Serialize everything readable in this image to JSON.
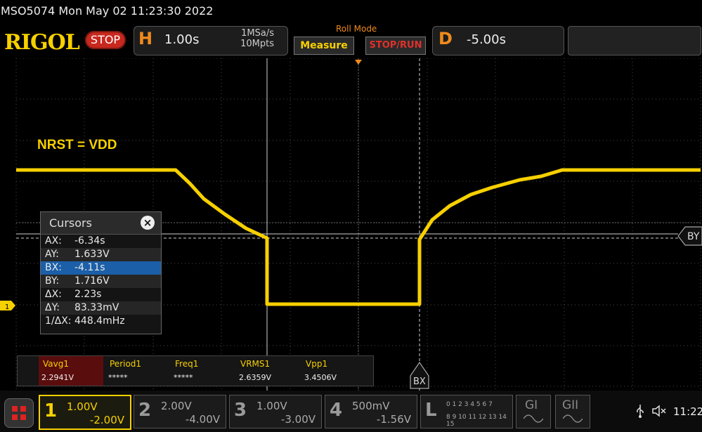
{
  "header": {
    "title": "MSO5074  Mon May 02 11:23:30 2022",
    "logo": "RIGOL",
    "run_state": "STOP"
  },
  "horizontal": {
    "letter": "H",
    "timebase": "1.00s",
    "sample_rate": "1MSa/s",
    "memory_depth": "10Mpts"
  },
  "mode": {
    "label": "Roll Mode",
    "measure_button": "Measure",
    "stoprun_button": "STOP/RUN"
  },
  "delay": {
    "letter": "D",
    "value": "-5.00s"
  },
  "annotation": "NRST = VDD",
  "markers": {
    "ch1": "1",
    "by": "BY",
    "bx": "BX"
  },
  "cursors": {
    "title": "Cursors",
    "close": "×",
    "rows": [
      {
        "k": "AX:",
        "v": "-6.34s"
      },
      {
        "k": "AY:",
        "v": "1.633V"
      },
      {
        "k": "BX:",
        "v": "-4.11s"
      },
      {
        "k": "BY:",
        "v": "1.716V"
      },
      {
        "k": "ΔX:",
        "v": "2.23s"
      },
      {
        "k": "ΔY:",
        "v": "83.33mV"
      },
      {
        "k": "1/ΔX:",
        "v": "448.4mHz"
      }
    ]
  },
  "measurements": [
    {
      "name": "Vavg1",
      "value": "2.2941V"
    },
    {
      "name": "Period1",
      "value": "*****"
    },
    {
      "name": "Freq1",
      "value": "*****"
    },
    {
      "name": "VRMS1",
      "value": "2.6359V"
    },
    {
      "name": "Vpp1",
      "value": "3.4506V"
    }
  ],
  "channels": [
    {
      "num": "1",
      "scale": "1.00V",
      "offset": "-2.00V",
      "color": "#f7d000"
    },
    {
      "num": "2",
      "scale": "2.00V",
      "offset": "-4.00V",
      "color": "#9a9a9a"
    },
    {
      "num": "3",
      "scale": "1.00V",
      "offset": "-3.00V",
      "color": "#9a9a9a"
    },
    {
      "num": "4",
      "scale": "500mV",
      "offset": "-1.56V",
      "color": "#9a9a9a"
    }
  ],
  "logic": {
    "letter": "L",
    "row1": "0 1 2 3  4 5 6 7",
    "row2": "8 9 10 11 12 13 14 15"
  },
  "generators": [
    "GI",
    "GII"
  ],
  "status": {
    "time": "11:22",
    "usb_icon": "usb-icon",
    "sound_icon": "speaker-muted-icon"
  },
  "colors": {
    "ch1": "#f7d000",
    "accent": "#f08a1c",
    "cursor_line": "#cfcfcf",
    "selected_row": "#1b5fa8"
  }
}
